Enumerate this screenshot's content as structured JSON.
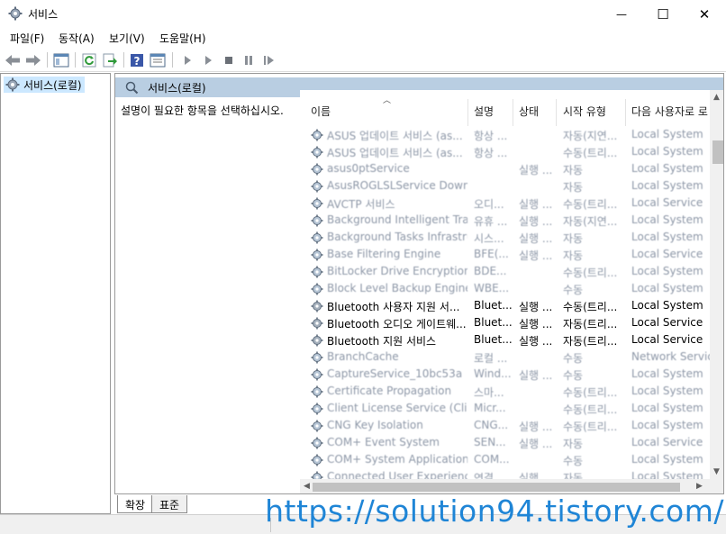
{
  "window": {
    "title": "서비스",
    "minimize_glyph": "—",
    "maximize_glyph": "☐",
    "close_glyph": "✕"
  },
  "menu": [
    {
      "label": "파일(F)"
    },
    {
      "label": "동작(A)"
    },
    {
      "label": "보기(V)"
    },
    {
      "label": "도움말(H)"
    }
  ],
  "toolbar": {
    "icons": [
      "back-icon",
      "forward-icon",
      "show-hide-console-tree-icon",
      "refresh-icon",
      "export-list-icon",
      "help-icon",
      "properties-icon",
      "start-service-icon",
      "start-service-alt-icon",
      "stop-service-icon",
      "pause-service-icon",
      "restart-service-icon"
    ]
  },
  "tree": {
    "item_label": "서비스(로컬)"
  },
  "pane": {
    "header_title": "서비스(로컬)",
    "description": "설명이 필요한 항목을 선택하십시오."
  },
  "columns": {
    "name": "이름",
    "desc": "설명",
    "state": "상태",
    "start": "시작 유형",
    "logon": "다음 사용자로 로"
  },
  "services": [
    {
      "name": "ASUS 업데이트 서비스 (as...",
      "desc": "항상 ...",
      "state": "",
      "start": "자동(지연...",
      "logon": "Local System",
      "blurred": true
    },
    {
      "name": "ASUS 업데이트 서비스 (as...",
      "desc": "항상 ...",
      "state": "",
      "start": "수동(트리...",
      "logon": "Local System",
      "blurred": true
    },
    {
      "name": "asus0ptService",
      "desc": "",
      "state": "실행 ...",
      "start": "자동",
      "logon": "Local System",
      "blurred": true
    },
    {
      "name": "AsusROGLSLService Downl...",
      "desc": "",
      "state": "",
      "start": "자동",
      "logon": "Local System",
      "blurred": true
    },
    {
      "name": "AVCTP 서비스",
      "desc": "오디...",
      "state": "실행 ...",
      "start": "수동(트리...",
      "logon": "Local Service",
      "blurred": true
    },
    {
      "name": "Background Intelligent Tra...",
      "desc": "유휴 ...",
      "state": "실행 ...",
      "start": "자동(지연...",
      "logon": "Local System",
      "blurred": true
    },
    {
      "name": "Background Tasks Infrastru...",
      "desc": "시스...",
      "state": "실행 ...",
      "start": "자동",
      "logon": "Local System",
      "blurred": true
    },
    {
      "name": "Base Filtering Engine",
      "desc": "BFE(...",
      "state": "실행 ...",
      "start": "자동",
      "logon": "Local Service",
      "blurred": true
    },
    {
      "name": "BitLocker Drive Encryption ...",
      "desc": "BDE...",
      "state": "",
      "start": "수동(트리...",
      "logon": "Local System",
      "blurred": true
    },
    {
      "name": "Block Level Backup Engine ...",
      "desc": "WBE...",
      "state": "",
      "start": "수동",
      "logon": "Local System",
      "blurred": true
    },
    {
      "name": "Bluetooth 사용자 지원 서...",
      "desc": "Bluet...",
      "state": "실행 ...",
      "start": "수동(트리...",
      "logon": "Local System",
      "blurred": false
    },
    {
      "name": "Bluetooth 오디오 게이트웨...",
      "desc": "Bluet...",
      "state": "실행 ...",
      "start": "자동(트리...",
      "logon": "Local Service",
      "blurred": false
    },
    {
      "name": "Bluetooth 지원 서비스",
      "desc": "Bluet...",
      "state": "실행 ...",
      "start": "자동(트리...",
      "logon": "Local Service",
      "blurred": false
    },
    {
      "name": "BranchCache",
      "desc": "로컬 ...",
      "state": "",
      "start": "수동",
      "logon": "Network Service",
      "blurred": true
    },
    {
      "name": "CaptureService_10bc53a",
      "desc": "Wind...",
      "state": "실행 ...",
      "start": "수동",
      "logon": "Local System",
      "blurred": true
    },
    {
      "name": "Certificate Propagation",
      "desc": "스마...",
      "state": "",
      "start": "수동(트리...",
      "logon": "Local System",
      "blurred": true
    },
    {
      "name": "Client License Service (Clip...",
      "desc": "Micr...",
      "state": "",
      "start": "수동(트리...",
      "logon": "Local System",
      "blurred": true
    },
    {
      "name": "CNG Key Isolation",
      "desc": "CNG...",
      "state": "실행 ...",
      "start": "수동(트리...",
      "logon": "Local System",
      "blurred": true
    },
    {
      "name": "COM+ Event System",
      "desc": "SEN...",
      "state": "실행 ...",
      "start": "자동",
      "logon": "Local Service",
      "blurred": true
    },
    {
      "name": "COM+ System Application",
      "desc": "COM...",
      "state": "",
      "start": "수동",
      "logon": "Local System",
      "blurred": true
    },
    {
      "name": "Connected User Experience...",
      "desc": "연결...",
      "state": "실행 ...",
      "start": "자동",
      "logon": "Local System",
      "blurred": true
    }
  ],
  "tabs": [
    {
      "label": "확장"
    },
    {
      "label": "표준"
    }
  ],
  "watermark": "https://solution94.tistory.com/",
  "colors": {
    "header_band": "#b9cee2",
    "tree_selection": "#cce8ff",
    "watermark": "#1f85d6"
  }
}
